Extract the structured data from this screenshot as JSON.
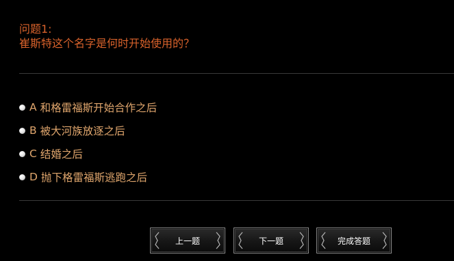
{
  "question": {
    "number_label": "问题1:",
    "text": "崔斯特这个名字是何时开始使用的？"
  },
  "options": [
    {
      "letter": "A",
      "text": "和格雷福斯开始合作之后"
    },
    {
      "letter": "B",
      "text": "被大河族放逐之后"
    },
    {
      "letter": "C",
      "text": "结婚之后"
    },
    {
      "letter": "D",
      "text": "抛下格雷福斯逃跑之后"
    }
  ],
  "buttons": {
    "prev": "上一题",
    "next": "下一题",
    "finish": "完成答题"
  },
  "colors": {
    "background": "#000000",
    "question": "#d9622b",
    "option": "#e0a66d",
    "button_text": "#ffffff"
  }
}
